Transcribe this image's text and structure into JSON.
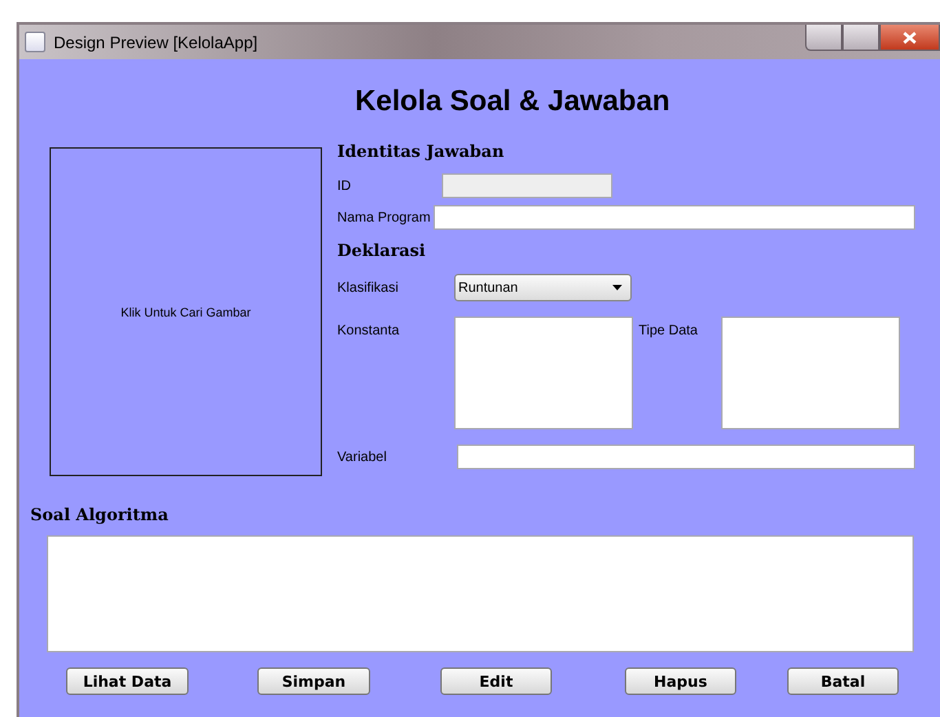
{
  "window": {
    "title": "Design Preview [KelolaApp]"
  },
  "heading": "Kelola Soal & Jawaban",
  "image_box": {
    "label": "Klik Untuk Cari Gambar"
  },
  "sections": [
    {
      "title": "Identitas Jawaban"
    },
    {
      "title": "Deklarasi"
    }
  ],
  "id_field": {
    "label": "ID",
    "disabled": true
  },
  "nama_program": {
    "label": "Nama Program"
  },
  "klasifikasi": {
    "label": "Klasifikasi",
    "value": "Runtunan"
  },
  "konstanta": {
    "label": "Konstanta"
  },
  "tipe_data": {
    "label": "Tipe Data"
  },
  "variabel": {
    "label": "Variabel"
  },
  "soal": {
    "label": "Soal Algoritma"
  },
  "buttons": [
    "Lihat Data",
    "Simpan",
    "Edit",
    "Hapus",
    "Batal"
  ]
}
